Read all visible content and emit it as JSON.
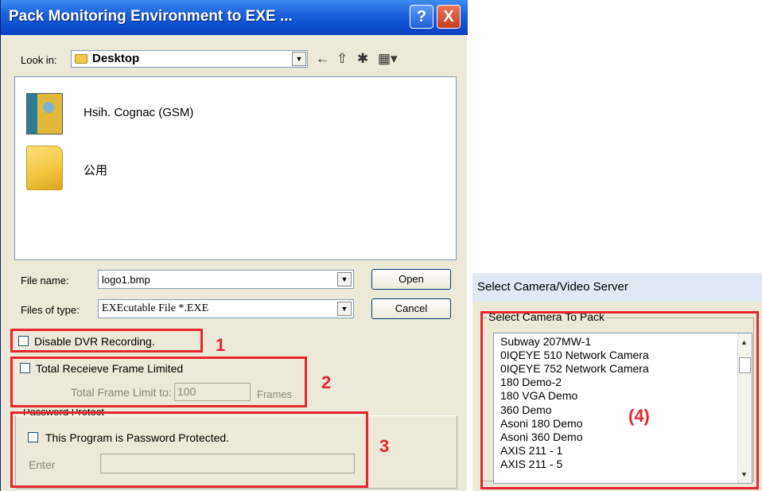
{
  "dialog": {
    "title": "Pack Monitoring Environment to EXE ...",
    "help_label": "?",
    "close_label": "X",
    "look_in_label": "Look in:",
    "look_in_value": "Desktop",
    "files": [
      {
        "name": "Hsih. Cognac (GSM)",
        "icon": "contact-icon"
      },
      {
        "name": "公用",
        "icon": "folder-icon"
      }
    ],
    "file_name_label": "File name:",
    "file_name_value": "logo1.bmp",
    "files_of_type_label": "Files of type:",
    "files_of_type_value": "EXEcutable File *.EXE",
    "open_button": "Open",
    "cancel_button": "Cancel",
    "disable_dvr_label": "Disable DVR Recording.",
    "total_frame_limited_label": "Total Receieve Frame Limited",
    "total_frame_limit_label": "Total Frame Limit to:",
    "total_frame_limit_value": "100",
    "frames_label": "Frames",
    "password_group_label": "Password Protect",
    "password_protected_label": "This Program is Password Protected.",
    "enter_label": "Enter"
  },
  "annotations": {
    "n1": "1",
    "n2": "2",
    "n3": "3",
    "n4": "(4)",
    "color": "#e8262e"
  },
  "camera_panel": {
    "title": "Select Camera/Video Server",
    "group_label": "Select Camera To Pack",
    "items": [
      "Subway 207MW-1",
      "0IQEYE 510 Network Camera",
      "0IQEYE 752 Network Camera",
      "180 Demo-2",
      "180 VGA Demo",
      "360 Demo",
      "Asoni 180 Demo",
      "Asoni 360 Demo",
      "AXIS 211 - 1",
      "AXIS 211 - 5"
    ]
  }
}
